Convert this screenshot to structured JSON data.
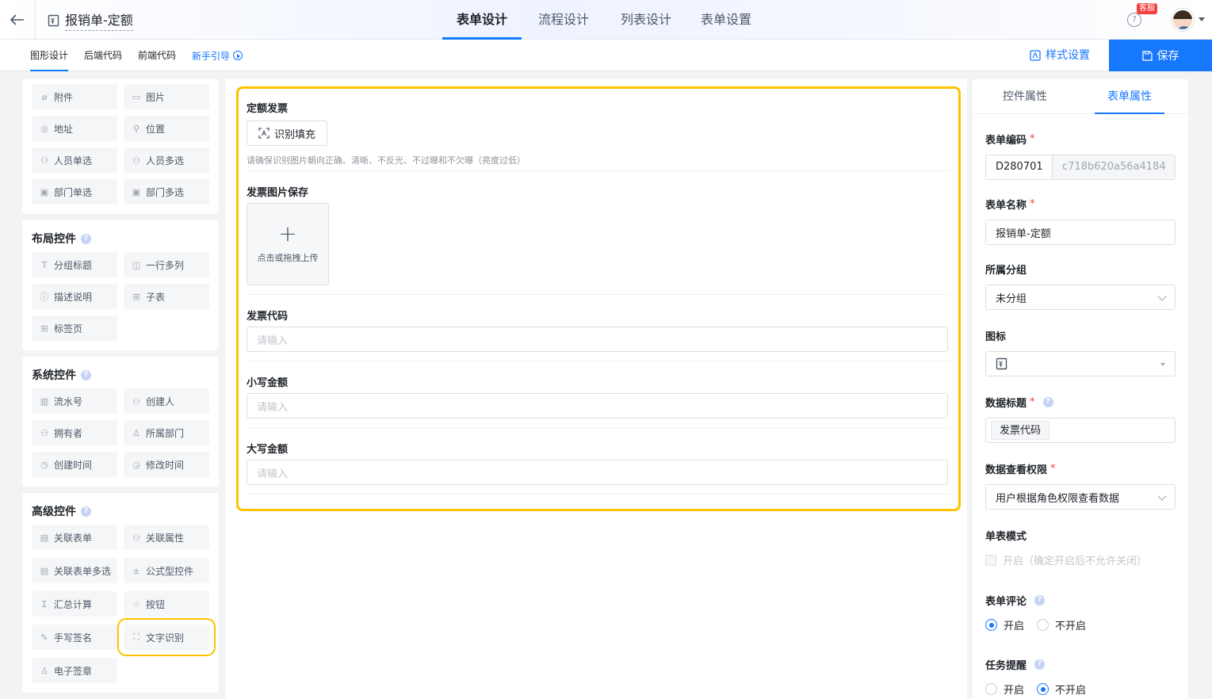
{
  "header": {
    "title": "报销单-定额",
    "tabs": [
      {
        "label": "表单设计",
        "active": true
      },
      {
        "label": "流程设计",
        "active": false
      },
      {
        "label": "列表设计",
        "active": false
      },
      {
        "label": "表单设置",
        "active": false
      }
    ],
    "service_badge": "客服",
    "help_glyph": "?"
  },
  "subbar": {
    "tabs": [
      "图形设计",
      "后端代码",
      "前端代码"
    ],
    "guide_label": "新手引导",
    "style_settings_label": "样式设置",
    "save_label": "保存"
  },
  "palette": {
    "basic_items": [
      "附件",
      "图片",
      "地址",
      "位置",
      "人员单选",
      "人员多选",
      "部门单选",
      "部门多选"
    ],
    "layout": {
      "title": "布局控件",
      "items": [
        "分组标题",
        "一行多列",
        "描述说明",
        "子表",
        "标签页"
      ]
    },
    "system": {
      "title": "系统控件",
      "items": [
        "流水号",
        "创建人",
        "拥有者",
        "所属部门",
        "创建时间",
        "修改时间"
      ]
    },
    "advanced": {
      "title": "高级控件",
      "items": [
        "关联表单",
        "关联属性",
        "关联表单多选",
        "公式型控件",
        "汇总计算",
        "按钮",
        "手写签名",
        "文字识别",
        "电子签章"
      ]
    },
    "highlighted_item": "文字识别"
  },
  "form": {
    "ocr_field": {
      "label": "定额发票",
      "button_label": "识别填充",
      "hint": "请确保识别图片朝向正确、清晰、不反光、不过曝和不欠曝（亮度过低）"
    },
    "image_field": {
      "label": "发票图片保存",
      "upload_label": "点击或拖拽上传"
    },
    "inputs": [
      {
        "label": "发票代码",
        "placeholder": "请输入"
      },
      {
        "label": "小写金额",
        "placeholder": "请输入"
      },
      {
        "label": "大写金额",
        "placeholder": "请输入"
      }
    ]
  },
  "properties": {
    "tabs": [
      {
        "label": "控件属性",
        "active": false
      },
      {
        "label": "表单属性",
        "active": true
      }
    ],
    "form_code": {
      "label": "表单编码",
      "prefix": "D280701",
      "suffix": "c718b620a56a4184"
    },
    "form_name": {
      "label": "表单名称",
      "value": "报销单-定额"
    },
    "group": {
      "label": "所属分组",
      "value": "未分组"
    },
    "icon": {
      "label": "图标"
    },
    "data_title": {
      "label": "数据标题",
      "tag": "发票代码"
    },
    "permission": {
      "label": "数据查看权限",
      "value": "用户根据角色权限查看数据"
    },
    "single_mode": {
      "label": "单表模式",
      "checkbox_label": "开启（确定开启后不允许关闭）"
    },
    "comments": {
      "label": "表单评论",
      "options": [
        "开启",
        "不开启"
      ],
      "selected": 0
    },
    "task_reminder": {
      "label": "任务提醒",
      "options": [
        "开启",
        "不开启"
      ],
      "selected": 1
    }
  },
  "colors": {
    "accent": "#1677ff",
    "highlight": "#fcc200",
    "required": "#f53f3f"
  }
}
